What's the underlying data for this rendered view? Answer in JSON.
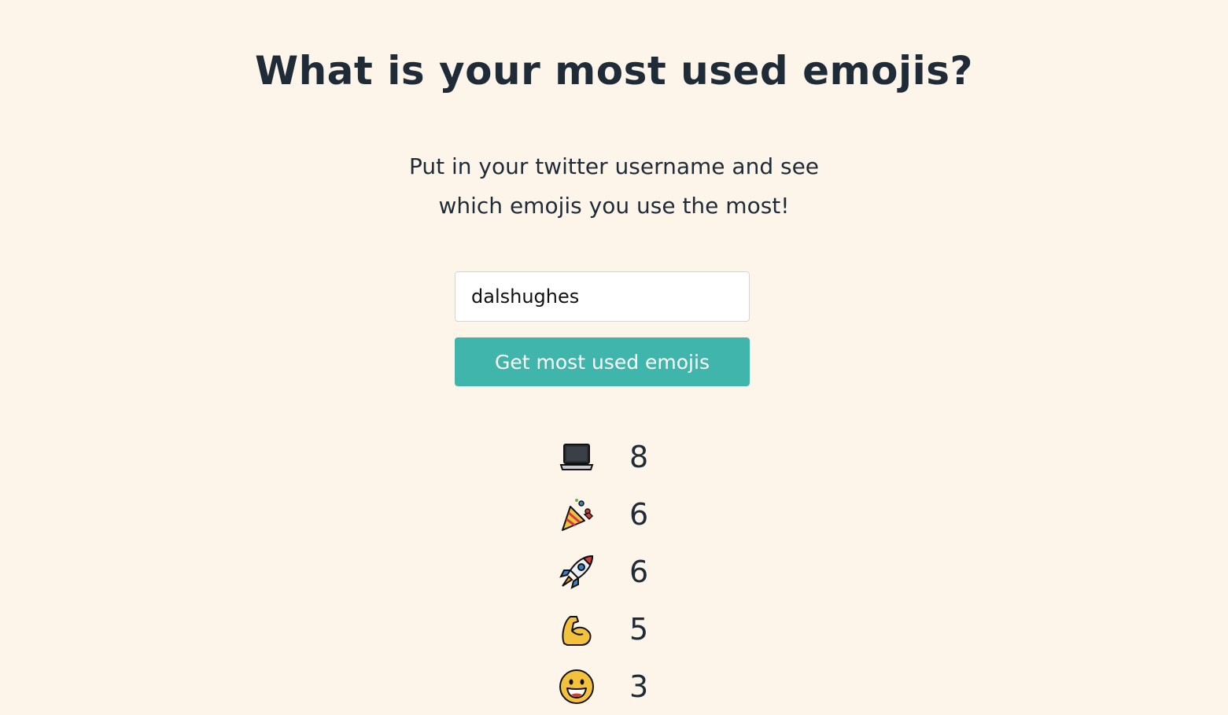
{
  "header": {
    "title": "What is your most used emojis?"
  },
  "intro": {
    "line1": "Put in your twitter username and see",
    "line2": "which emojis you use the most!"
  },
  "form": {
    "username_value": "dalshughes",
    "submit_label": "Get most used emojis"
  },
  "results": [
    {
      "icon": "laptop-icon",
      "count": "8"
    },
    {
      "icon": "party-popper-icon",
      "count": "6"
    },
    {
      "icon": "rocket-icon",
      "count": "6"
    },
    {
      "icon": "flexed-biceps-icon",
      "count": "5"
    },
    {
      "icon": "grinning-face-icon",
      "count": "3"
    }
  ],
  "colors": {
    "background": "#fdf5ea",
    "text": "#1f2b36",
    "button": "#40b5ac",
    "button_text": "#ffffff"
  }
}
